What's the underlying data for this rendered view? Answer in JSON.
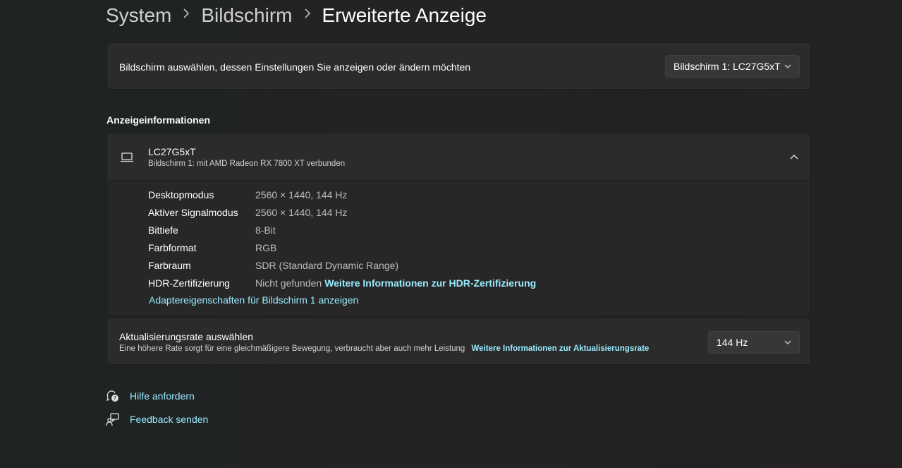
{
  "breadcrumb": {
    "items": [
      "System",
      "Bildschirm",
      "Erweiterte Anzeige"
    ],
    "separator": ">"
  },
  "display_select": {
    "label": "Bildschirm auswählen, dessen Einstellungen Sie anzeigen oder ändern möchten",
    "selected": "Bildschirm 1: LC27G5xT"
  },
  "section_title": "Anzeigeinformationen",
  "monitor": {
    "name": "LC27G5xT",
    "subtitle": "Bildschirm 1: mit AMD Radeon RX 7800 XT verbunden",
    "icon": "laptop-icon",
    "expanded": true
  },
  "info_rows": [
    {
      "key": "Desktopmodus",
      "value": "2560 × 1440, 144 Hz"
    },
    {
      "key": "Aktiver Signalmodus",
      "value": "2560 × 1440, 144 Hz"
    },
    {
      "key": "Bittiefe",
      "value": "8-Bit"
    },
    {
      "key": "Farbformat",
      "value": "RGB"
    },
    {
      "key": "Farbraum",
      "value": "SDR (Standard Dynamic Range)"
    },
    {
      "key": "HDR-Zertifizierung",
      "value": "Nicht gefunden",
      "link": "Weitere Informationen zur HDR-Zertifizierung"
    }
  ],
  "adapter_link": "Adaptereigenschaften für Bildschirm 1 anzeigen",
  "refresh": {
    "title": "Aktualisierungsrate auswählen",
    "description": "Eine höhere Rate sorgt für eine gleichmäßigere Bewegung, verbraucht aber auch mehr Leistung",
    "link": "Weitere Informationen zur Aktualisierungsrate",
    "selected": "144 Hz"
  },
  "footer_links": [
    {
      "label": "Hilfe anfordern",
      "icon": "help-icon"
    },
    {
      "label": "Feedback senden",
      "icon": "feedback-icon"
    }
  ],
  "colors": {
    "background": "#202020",
    "card": "#2b2b2b",
    "accent_link": "#99ebff",
    "muted_text": "#bdbdbd"
  }
}
